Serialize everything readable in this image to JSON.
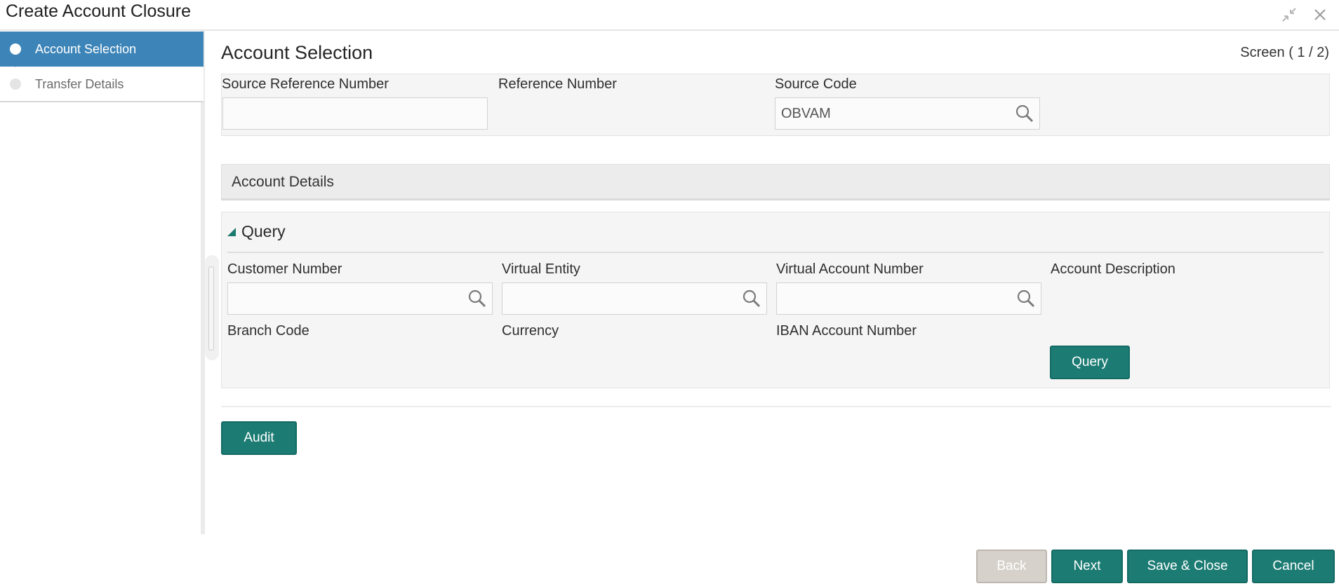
{
  "window": {
    "title": "Create Account Closure",
    "minimize_icon": "minimize-icon",
    "close_icon": "close-icon"
  },
  "sidebar": {
    "steps": [
      {
        "label": "Account Selection",
        "state": "active"
      },
      {
        "label": "Transfer Details",
        "state": "inactive"
      }
    ]
  },
  "main": {
    "title": "Account Selection",
    "screen_indicator": "Screen ( 1 / 2)",
    "header_fields": {
      "source_reference_number": {
        "label": "Source Reference Number",
        "value": ""
      },
      "reference_number": {
        "label": "Reference Number",
        "value": ""
      },
      "source_code": {
        "label": "Source Code",
        "value": "OBVAM"
      }
    },
    "account_details": {
      "label": "Account Details"
    },
    "query": {
      "section_label": "Query",
      "fields": {
        "customer_number": {
          "label": "Customer Number",
          "value": ""
        },
        "virtual_entity": {
          "label": "Virtual Entity",
          "value": ""
        },
        "virtual_account_number": {
          "label": "Virtual Account Number",
          "value": ""
        },
        "account_description": {
          "label": "Account Description"
        },
        "branch_code": {
          "label": "Branch Code"
        },
        "currency": {
          "label": "Currency"
        },
        "iban_account_number": {
          "label": "IBAN Account Number"
        }
      },
      "button_label": "Query"
    },
    "audit_label": "Audit"
  },
  "footer": {
    "back": "Back",
    "next": "Next",
    "save_close": "Save & Close",
    "cancel": "Cancel"
  },
  "colors": {
    "accent": "#1c7c74",
    "step_active": "#3d85b8",
    "disabled": "#d6d1cb"
  }
}
